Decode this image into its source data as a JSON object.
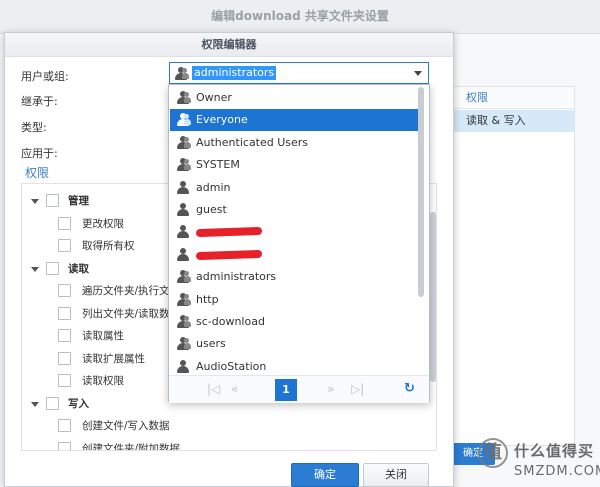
{
  "background_window": {
    "title": "编辑download 共享文件夹设置",
    "column_header": "权限",
    "cell_value": "读取 & 写入",
    "button_label": "确定"
  },
  "dialog": {
    "title": "权限编辑器",
    "labels": {
      "user_or_group": "用户或组:",
      "inherit_from": "继承于:",
      "type": "类型:",
      "apply_to": "应用于:"
    },
    "selected_value": "administrators",
    "permissions_heading": "权限",
    "tree": [
      {
        "label": "管理",
        "level": 0,
        "expanded": true
      },
      {
        "label": "更改权限",
        "level": 1
      },
      {
        "label": "取得所有权",
        "level": 1
      },
      {
        "label": "读取",
        "level": 0,
        "expanded": true
      },
      {
        "label": "遍历文件夹/执行文件",
        "level": 1
      },
      {
        "label": "列出文件夹/读取数据",
        "level": 1
      },
      {
        "label": "读取属性",
        "level": 1
      },
      {
        "label": "读取扩展属性",
        "level": 1
      },
      {
        "label": "读取权限",
        "level": 1
      },
      {
        "label": "写入",
        "level": 0,
        "expanded": true
      },
      {
        "label": "创建文件/写入数据",
        "level": 1
      },
      {
        "label": "创建文件夹/附加数据",
        "level": 1
      }
    ],
    "ok_button": "确定",
    "close_button": "关闭"
  },
  "dropdown": {
    "items": [
      {
        "label": "Owner",
        "icon": "group-icon",
        "selected": false
      },
      {
        "label": "Everyone",
        "icon": "group-icon",
        "selected": true
      },
      {
        "label": "Authenticated Users",
        "icon": "group-icon",
        "selected": false
      },
      {
        "label": "SYSTEM",
        "icon": "group-icon",
        "selected": false
      },
      {
        "label": "admin",
        "icon": "user-icon",
        "selected": false
      },
      {
        "label": "guest",
        "icon": "user-icon",
        "selected": false
      },
      {
        "label": "",
        "icon": "user-icon",
        "redacted": true
      },
      {
        "label": "",
        "icon": "user-icon",
        "redacted": true
      },
      {
        "label": "administrators",
        "icon": "group-icon",
        "selected": false
      },
      {
        "label": "http",
        "icon": "group-icon",
        "selected": false
      },
      {
        "label": "sc-download",
        "icon": "group-icon",
        "selected": false
      },
      {
        "label": "users",
        "icon": "group-icon",
        "selected": false
      },
      {
        "label": "AudioStation",
        "icon": "user-icon",
        "selected": false
      }
    ],
    "pager": {
      "current_page": "1",
      "first": "|◁",
      "prev": "«",
      "next": "»",
      "last": "▷|",
      "refresh": "↻"
    }
  },
  "watermark": {
    "logo": "值",
    "top_text": "什么值得买",
    "bottom_text": "SMZDM.COM"
  },
  "colors": {
    "accent": "#1e74d2",
    "selection_bg": "#1e74d2",
    "link_blue": "#3b7fc4",
    "redaction": "#e8202a"
  }
}
